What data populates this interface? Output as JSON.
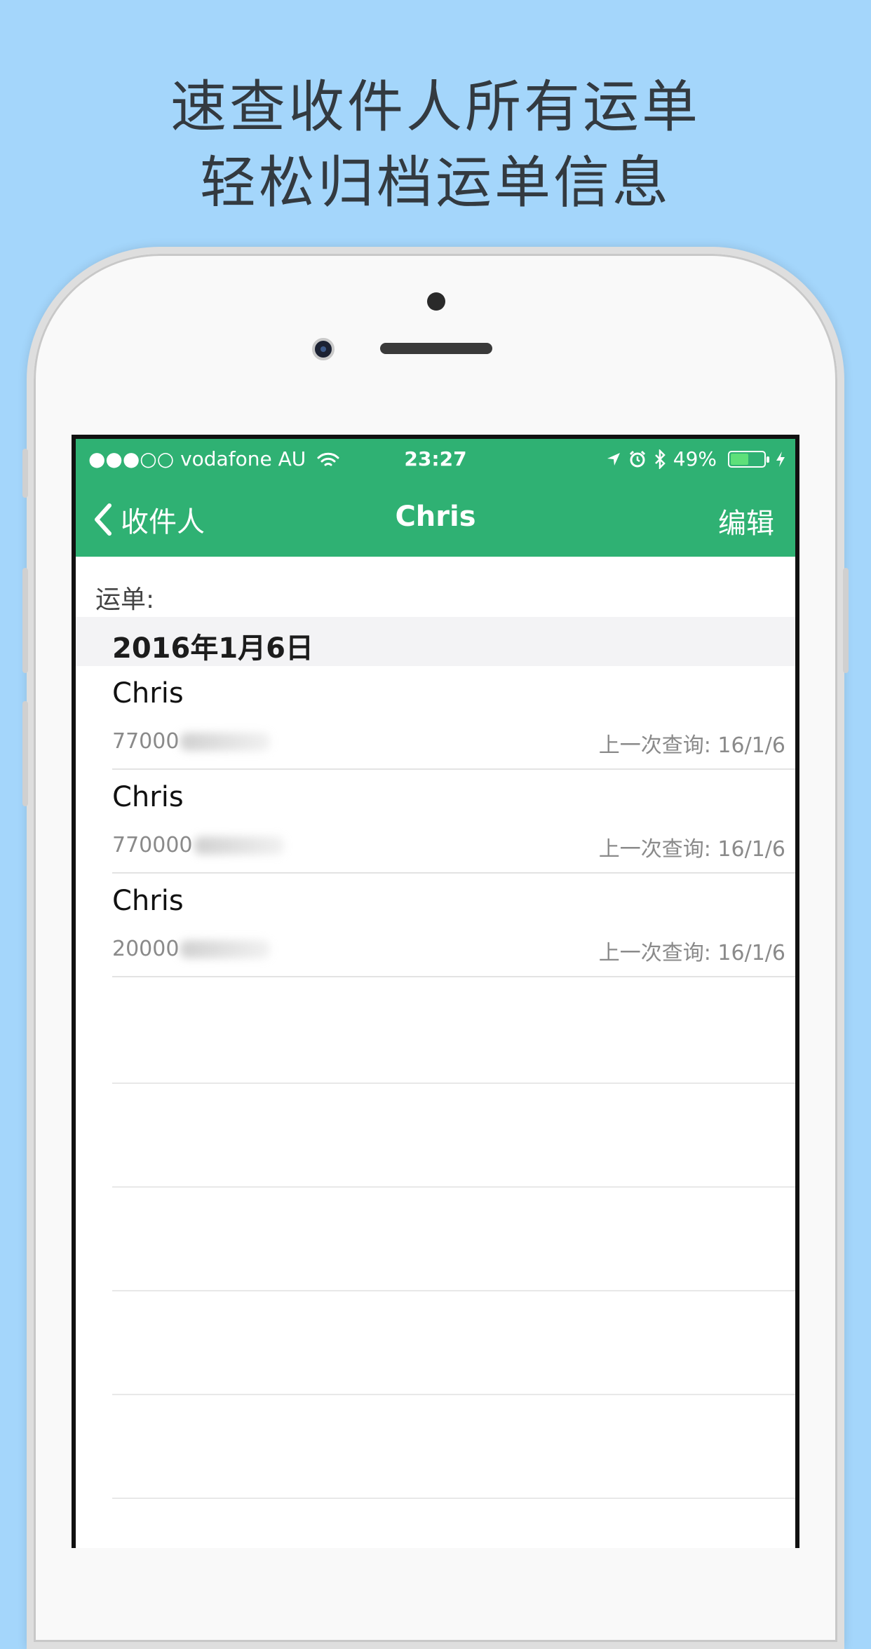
{
  "promo": {
    "line1": "速查收件人所有运单",
    "line2": "轻松归档运单信息"
  },
  "status_bar": {
    "signal": "●●●○○",
    "carrier": "vodafone AU",
    "time": "23:27",
    "battery_percent": "49%",
    "battery_level": 0.49
  },
  "nav": {
    "back_label": "收件人",
    "title": "Chris",
    "edit_label": "编辑"
  },
  "section_label": "运单:",
  "date_header": "2016年1月6日",
  "shipments": [
    {
      "name": "Chris",
      "number_prefix": "77000",
      "last_query": "上一次查询: 16/1/6"
    },
    {
      "name": "Chris",
      "number_prefix": "770000",
      "last_query": "上一次查询: 16/1/6"
    },
    {
      "name": "Chris",
      "number_prefix": "20000",
      "last_query": "上一次查询: 16/1/6"
    }
  ],
  "colors": {
    "background": "#a4d6fb",
    "accent_green": "#2fb173"
  }
}
